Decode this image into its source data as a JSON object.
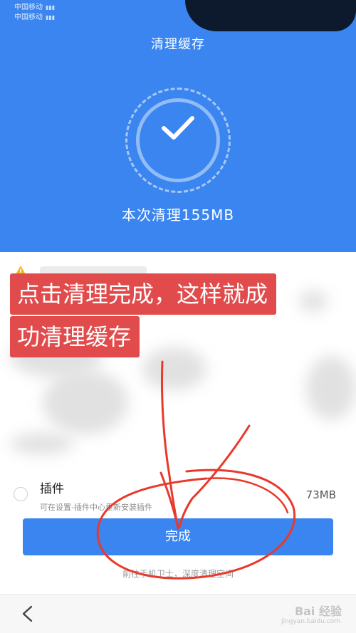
{
  "status_bar": {
    "carrier_1": "中国移动",
    "carrier_2": "中国移动"
  },
  "header": {
    "title": "清理缓存",
    "result": "本次清理155MB",
    "icon": "check-icon"
  },
  "list": {
    "plugin": {
      "name": "插件",
      "description": "可在设置-插件中心重新安装插件",
      "size": "73MB"
    }
  },
  "actions": {
    "done_label": "完成",
    "footer_link": "前往手机卫士，深度清理空间"
  },
  "annotation": {
    "line1": "点击清理完成，这样就成",
    "line2": "功清理缓存"
  },
  "watermark": {
    "brand": "Bai 经验",
    "url": "jingyan.baidu.com"
  },
  "colors": {
    "primary": "#3a85ef",
    "annotation_red": "#e14b4b",
    "scribble_red": "#e8392b"
  }
}
